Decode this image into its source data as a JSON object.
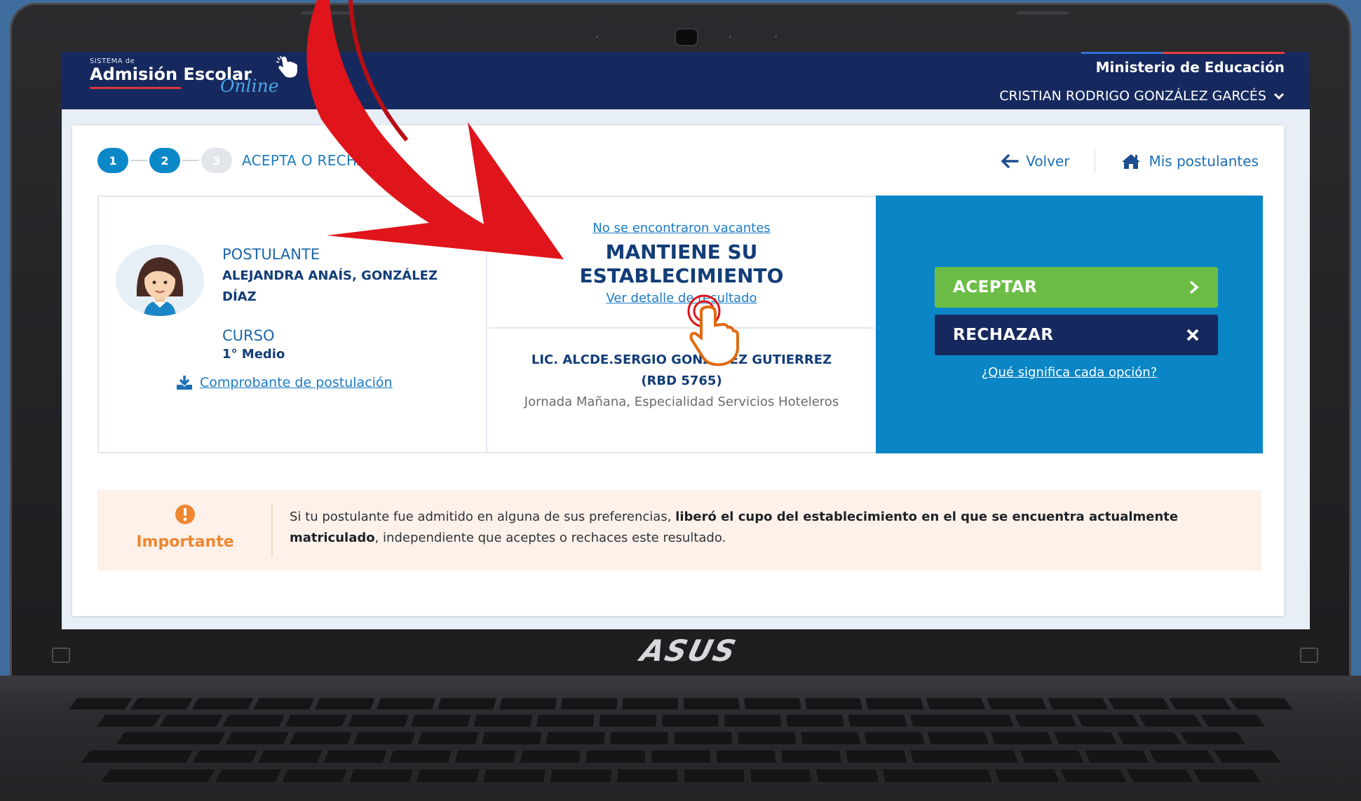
{
  "header": {
    "logo_small": "SISTEMA de",
    "logo_main": "Admisión Escolar",
    "logo_online": "Online",
    "ministry": "Ministerio de Educación",
    "user_name": "CRISTIAN RODRIGO GONZÁLEZ GARCÉS"
  },
  "steps": {
    "items": [
      "1",
      "2",
      "3"
    ],
    "label": "ACEPTA O RECHAZA"
  },
  "nav": {
    "back": "Volver",
    "home": "Mis postulantes"
  },
  "student": {
    "postulante_label": "POSTULANTE",
    "postulante_name": "ALEJANDRA ANAÍS, GONZÁLEZ DÍAZ",
    "curso_label": "CURSO",
    "curso_value": "1° Medio",
    "receipt_link": "Comprobante de postulación"
  },
  "result": {
    "no_vacancies": "No se encontraron vacantes",
    "status_line1": "MANTIENE SU",
    "status_line2": "ESTABLECIMIENTO",
    "detail_link": "Ver detalle de resultado",
    "school_name_line1": "LIC. ALCDE.SERGIO GONZÁLEZ GUTIERREZ",
    "school_name_line2": "(RBD 5765)",
    "school_detail": "Jornada Mañana, Especialidad Servicios Hoteleros"
  },
  "actions": {
    "accept": "ACEPTAR",
    "reject": "RECHAZAR",
    "help_link": "¿Qué significa cada opción?"
  },
  "notice": {
    "title": "Importante",
    "text_part1": "Si tu postulante fue admitido en alguna de sus preferencias, ",
    "text_bold": "liberó el cupo del establecimiento en el que se encuentra actualmente matriculado",
    "text_part2": ", independiente que aceptes o rechaces este resultado."
  },
  "device": {
    "brand": "ASUS"
  },
  "colors": {
    "header_bg": "#16295e",
    "primary_blue": "#0a86c6",
    "accept_green": "#6cbd45",
    "notice_orange": "#ee8730",
    "arrow_red": "#e0141b"
  }
}
